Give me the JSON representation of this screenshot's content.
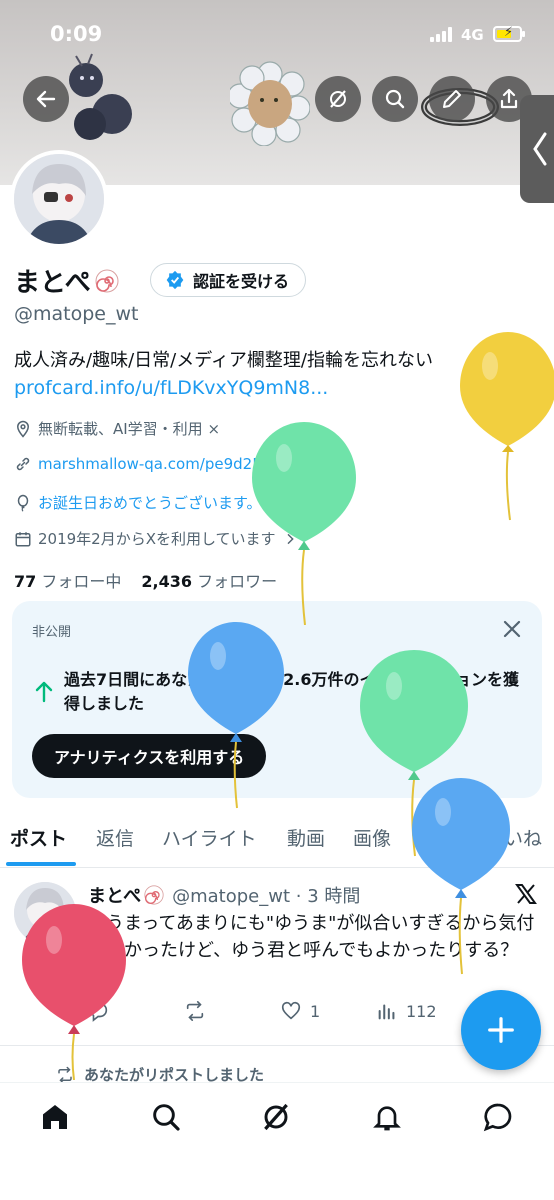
{
  "status_bar": {
    "time": "0:09",
    "network": "4G"
  },
  "profile": {
    "name": "まとぺ",
    "verify_button": "認証を受ける",
    "handle": "@matope_wt",
    "bio": "成人済み/趣味/日常/メディア欄整理/指輪を忘れない",
    "bio_link": "profcard.info/u/fLDKvxYQ9mN8...",
    "location": "無断転載、AI学習・利用 ×",
    "website": "marshmallow-qa.com/pe9d25brzeuc07...",
    "birthday": "お誕生日おめでとうございます。",
    "joined": "2019年2月からXを利用しています",
    "following_count": "77",
    "following_label": "フォロー中",
    "followers_count": "2,436",
    "followers_label": "フォロワー"
  },
  "analytics_card": {
    "tag": "非公開",
    "text": "過去7日間にあなたのポストは2.6万件のインプレッションを獲得しました",
    "button": "アナリティクスを利用する"
  },
  "tabs": [
    "ポスト",
    "返信",
    "ハイライト",
    "動画",
    "画像",
    "記事",
    "いいね"
  ],
  "post": {
    "name": "まとぺ",
    "meta": "@matope_wt · 3 時間",
    "text": "ゆうまってあまりにも\"ゆうま\"が似合いすぎるから気付かなかったけど、ゆう君と呼んでもよかったりする？",
    "likes": "1",
    "views": "112"
  },
  "repost_note": "あなたがリポストしました",
  "colors": {
    "accent": "#1d9bf0",
    "balloon_yellow": "#f2cf3f",
    "balloon_green": "#6fe3a9",
    "balloon_blue": "#5aa8f2",
    "balloon_red": "#e8506c"
  }
}
